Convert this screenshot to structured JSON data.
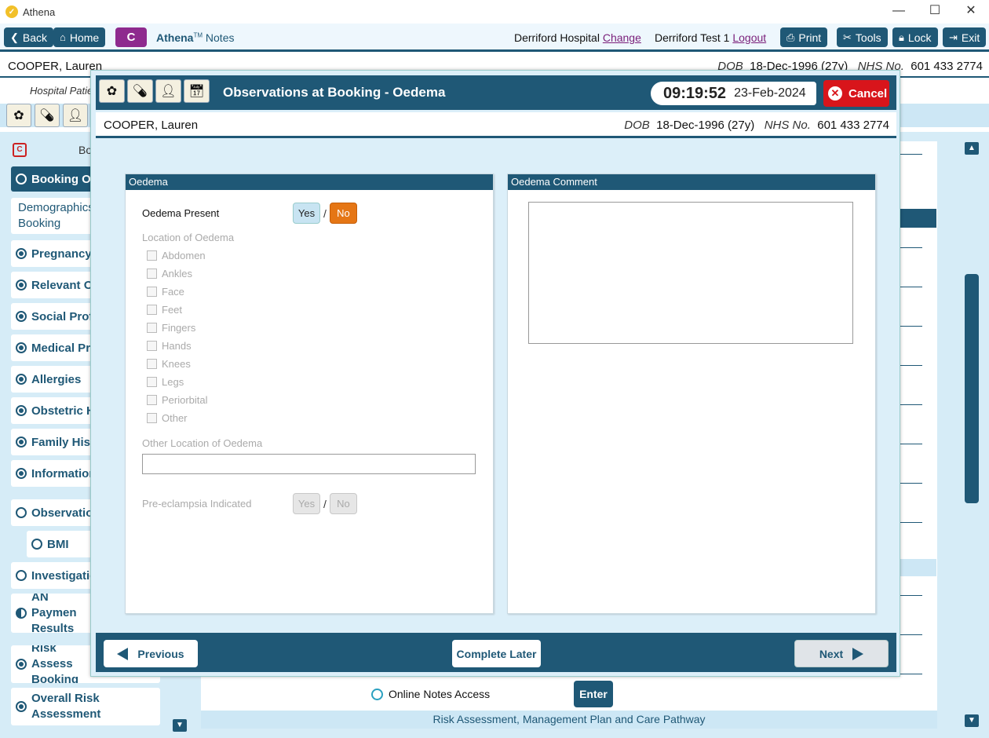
{
  "window": {
    "title": "Athena",
    "controls": [
      "—",
      "☐",
      "✕"
    ]
  },
  "toolbar": {
    "back": "Back",
    "home": "Home",
    "c_label": "C",
    "app_name": "Athena",
    "app_tm": "TM",
    "app_suffix": " Notes",
    "hospital": "Derriford Hospital",
    "change": "Change",
    "user": "Derriford Test 1",
    "logout": "Logout",
    "print": "Print",
    "tools": "Tools",
    "lock": "Lock",
    "exit": "Exit"
  },
  "patient": {
    "name": "COOPER, Lauren",
    "dob_label": "DOB",
    "dob": "18-Dec-1996 (27y)",
    "nhs_label": "NHS No.",
    "nhs": "601 433 2774",
    "hospital_patient": "Hospital Patie"
  },
  "nav": {
    "header": "Bo",
    "items": [
      {
        "label": "Booking Ov",
        "state": "active"
      },
      {
        "label": "Demographics Booking",
        "state": "none"
      },
      {
        "label": "Pregnancy I",
        "state": "filled"
      },
      {
        "label": "Relevant Ot",
        "state": "filled"
      },
      {
        "label": "Social Profil",
        "state": "filled"
      },
      {
        "label": "Medical Pro",
        "state": "filled"
      },
      {
        "label": "Allergies",
        "state": "filled"
      },
      {
        "label": "Obstetric H",
        "state": "filled"
      },
      {
        "label": "Family Histo",
        "state": "filled"
      },
      {
        "label": "Information",
        "state": "filled"
      },
      {
        "label": "Observation",
        "state": "empty"
      },
      {
        "label": "BMI",
        "state": "empty"
      },
      {
        "label": "Investigatio",
        "state": "empty"
      },
      {
        "label": "AN Paymen Results",
        "state": "half"
      },
      {
        "label": "Risk Assess Booking",
        "state": "filled"
      },
      {
        "label": "Overall Risk Assessment",
        "state": "filled"
      }
    ]
  },
  "background": {
    "online_notes": "Online Notes Access",
    "enter": "Enter",
    "risk_bar": "Risk Assessment, Management Plan and Care Pathway"
  },
  "modal": {
    "title": "Observations at Booking - Oedema",
    "time": "09:19:52",
    "date": "23-Feb-2024",
    "cancel": "Cancel",
    "oedema_panel": {
      "heading": "Oedema",
      "present_label": "Oedema Present",
      "yes": "Yes",
      "no": "No",
      "present_value": "No",
      "location_label": "Location of Oedema",
      "locations": [
        "Abdomen",
        "Ankles",
        "Face",
        "Feet",
        "Fingers",
        "Hands",
        "Knees",
        "Legs",
        "Periorbital",
        "Other"
      ],
      "other_location_label": "Other Location of Oedema",
      "other_location_value": "",
      "preeclampsia_label": "Pre-eclampsia Indicated"
    },
    "comment_panel": {
      "heading": "Oedema Comment",
      "value": ""
    },
    "footer": {
      "previous": "Previous",
      "complete_later": "Complete Later",
      "next": "Next"
    }
  },
  "colors": {
    "primary": "#1f5876",
    "accent_orange": "#e57615",
    "cancel_red": "#d8151b",
    "c_purple": "#8e2a8e",
    "panel_bg": "#dceff9"
  }
}
